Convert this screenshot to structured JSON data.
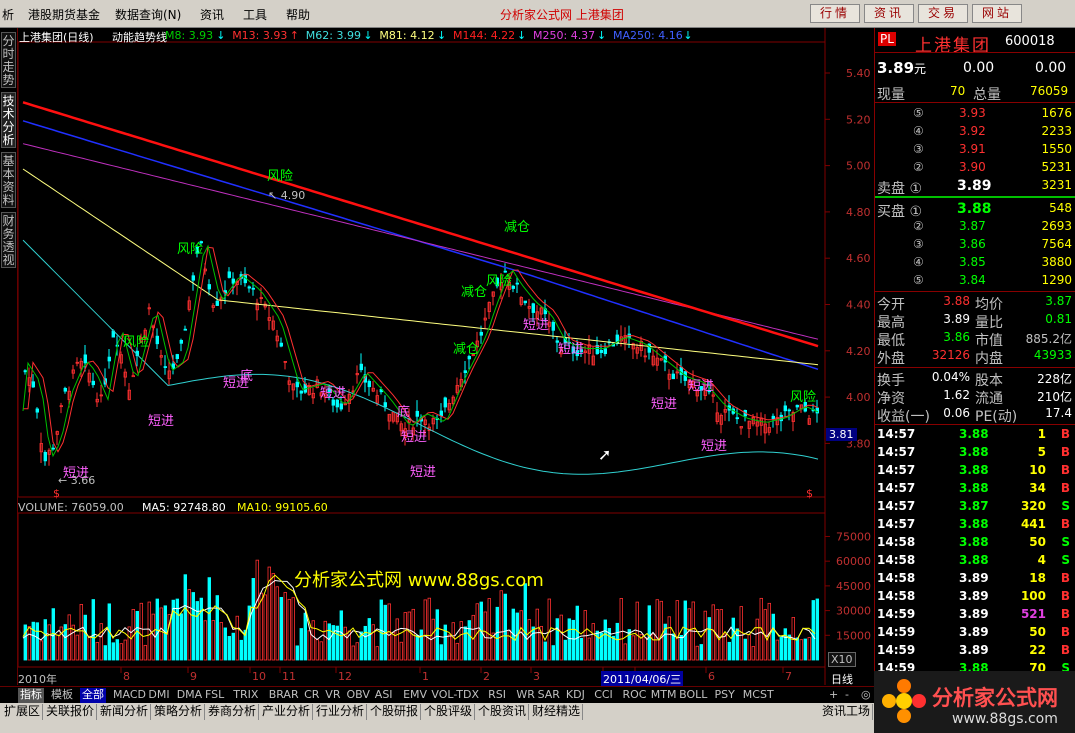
{
  "menu": {
    "items": [
      "析",
      "港股期货基金",
      "数据查询(N)",
      "资讯",
      "工具",
      "帮助"
    ]
  },
  "app_title": "分析家公式网 上港集团",
  "top_buttons": [
    "行情",
    "资讯",
    "交易",
    "网站"
  ],
  "side_tabs": [
    "分时走势",
    "技术分析",
    "基本资料",
    "财务透视"
  ],
  "chart_header": {
    "stock": "上港集团(日线)",
    "indicator": "动能趋势线",
    "mas": [
      {
        "label": "M8: 3.93",
        "color": "#00cc00",
        "arrow": "↓"
      },
      {
        "label": "M13: 3.93",
        "color": "#ff3030",
        "arrow": "↑"
      },
      {
        "label": "M62: 3.99",
        "color": "#40e0e0",
        "arrow": "↓"
      },
      {
        "label": "M81: 4.12",
        "color": "#ffff80",
        "arrow": "↓"
      },
      {
        "label": "M144: 4.22",
        "color": "#ff2020",
        "arrow": "↓"
      },
      {
        "label": "M250: 4.37",
        "color": "#e040e0",
        "arrow": "↓"
      },
      {
        "label": "MA250: 4.16",
        "color": "#4060ff",
        "arrow": "↓"
      }
    ]
  },
  "price_axis": [
    "5.40",
    "5.20",
    "5.00",
    "4.80",
    "4.60",
    "4.40",
    "4.20",
    "4.00",
    "3.80"
  ],
  "price_current": "3.81",
  "annotations": {
    "hi_label": "4.90",
    "lo_label": "3.66",
    "risk": "风险",
    "reduce": "减仓",
    "short_in": "短进",
    "bottom": "底",
    "dollar": "$"
  },
  "volume_header": {
    "vol": "VOLUME: 76059.00",
    "ma5": "MA5: 92748.80",
    "ma10": "MA10: 99105.60"
  },
  "volume_axis": [
    "75000",
    "60000",
    "45000",
    "30000",
    "15000"
  ],
  "volume_scale": "X10",
  "watermark": "分析家公式网 www.88gs.com",
  "date_axis": {
    "year": "2010年",
    "months": [
      "8",
      "9",
      "10",
      "11",
      "12",
      "1",
      "2",
      "3",
      "4",
      "5",
      "6",
      "7"
    ],
    "cursor_date": "2011/04/06/三",
    "period": "日线"
  },
  "quote": {
    "title_tag": "PL",
    "name": "上港集团",
    "code": "600018",
    "price": "3.89",
    "unit": "元",
    "change": "0.00",
    "pct": "0.00",
    "row_now_label": "现量",
    "row_now_value": "70",
    "row_total_label": "总量",
    "row_total_value": "76059",
    "asks": [
      {
        "lvl": "⑤",
        "price": "3.93",
        "vol": "1676"
      },
      {
        "lvl": "④",
        "price": "3.92",
        "vol": "2233"
      },
      {
        "lvl": "③",
        "price": "3.91",
        "vol": "1550"
      },
      {
        "lvl": "②",
        "price": "3.90",
        "vol": "5231"
      },
      {
        "lvl": "卖盘 ①",
        "price": "3.89",
        "vol": "3231"
      }
    ],
    "bids": [
      {
        "lvl": "买盘 ①",
        "price": "3.88",
        "vol": "548"
      },
      {
        "lvl": "②",
        "price": "3.87",
        "vol": "2693"
      },
      {
        "lvl": "③",
        "price": "3.86",
        "vol": "7564"
      },
      {
        "lvl": "④",
        "price": "3.85",
        "vol": "3880"
      },
      {
        "lvl": "⑤",
        "price": "3.84",
        "vol": "1290"
      }
    ],
    "stats": [
      {
        "l1": "今开",
        "v1": "3.88",
        "c1": "#ff3030",
        "l2": "均价",
        "v2": "3.87",
        "c2": "#00ff00"
      },
      {
        "l1": "最高",
        "v1": "3.89",
        "c1": "#ffffff",
        "l2": "量比",
        "v2": "0.81",
        "c2": "#00ff00"
      },
      {
        "l1": "最低",
        "v1": "3.86",
        "c1": "#00ff00",
        "l2": "市值",
        "v2": "885.2亿",
        "c2": "#c0c0c0"
      },
      {
        "l1": "外盘",
        "v1": "32126",
        "c1": "#ff3030",
        "l2": "内盘",
        "v2": "43933",
        "c2": "#00ff00"
      }
    ],
    "stats2": [
      {
        "l1": "换手",
        "v1": "0.04%",
        "l2": "股本",
        "v2": "228亿"
      },
      {
        "l1": "净资",
        "v1": "1.62",
        "l2": "流通",
        "v2": "210亿"
      },
      {
        "l1": "收益(一)",
        "v1": "0.06",
        "l2": "PE(动)",
        "v2": "17.4"
      }
    ],
    "ticks": [
      {
        "t": "14:57",
        "p": "3.88",
        "v": "1",
        "s": "B"
      },
      {
        "t": "14:57",
        "p": "3.88",
        "v": "5",
        "s": "B"
      },
      {
        "t": "14:57",
        "p": "3.88",
        "v": "10",
        "s": "B"
      },
      {
        "t": "14:57",
        "p": "3.88",
        "v": "34",
        "s": "B"
      },
      {
        "t": "14:57",
        "p": "3.87",
        "v": "320",
        "s": "S"
      },
      {
        "t": "14:57",
        "p": "3.88",
        "v": "441",
        "s": "B"
      },
      {
        "t": "14:58",
        "p": "3.88",
        "v": "50",
        "s": "S"
      },
      {
        "t": "14:58",
        "p": "3.88",
        "v": "4",
        "s": "S"
      },
      {
        "t": "14:58",
        "p": "3.89",
        "v": "18",
        "s": "B"
      },
      {
        "t": "14:58",
        "p": "3.89",
        "v": "100",
        "s": "B"
      },
      {
        "t": "14:59",
        "p": "3.89",
        "v": "521",
        "s": "B"
      },
      {
        "t": "14:59",
        "p": "3.89",
        "v": "50",
        "s": "B"
      },
      {
        "t": "14:59",
        "p": "3.89",
        "v": "22",
        "s": "B"
      },
      {
        "t": "14:59",
        "p": "3.88",
        "v": "70",
        "s": "S"
      }
    ]
  },
  "indicator_tabs": [
    "指标",
    "模板",
    "全部",
    "MACD",
    "DMI",
    "DMA",
    "FSL",
    "TRIX",
    "BRAR",
    "CR",
    "VR",
    "OBV",
    "ASI",
    "EMV",
    "VOL-TDX",
    "RSI",
    "WR",
    "SAR",
    "KDJ",
    "CCI",
    "ROC",
    "MTM",
    "BOLL",
    "PSY",
    "MCST"
  ],
  "nav_tabs": [
    "扩展区",
    "关联报价",
    "新闻分析",
    "策略分析",
    "券商分析",
    "产业分析",
    "行业分析",
    "个股研报",
    "个股评级",
    "个股资讯",
    "财经精选"
  ],
  "nav_right": "资讯工场",
  "logo": {
    "name": "分析家公式网",
    "url": "www.88gs.com"
  }
}
